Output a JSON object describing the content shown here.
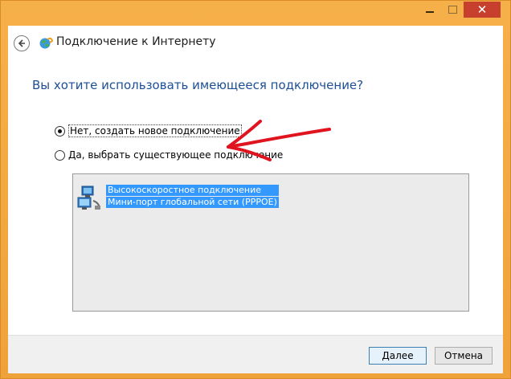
{
  "window": {
    "title_buttons": {
      "minimize": "minimize",
      "maximize": "maximize",
      "close": "close"
    }
  },
  "nav": {
    "title": "Подключение к Интернету"
  },
  "question": "Вы хотите использовать имеющееся подключение?",
  "options": [
    {
      "label": "Нет, создать новое подключение",
      "checked": true
    },
    {
      "label": "Да, выбрать существующее подключение",
      "checked": false
    }
  ],
  "connection_item": {
    "line1": "Высокоскоростное подключение",
    "line2": "Мини-порт глобальной сети (PPPOE)"
  },
  "buttons": {
    "next": "Далее",
    "cancel": "Отмена"
  },
  "colors": {
    "window_frame": "#f3a73e",
    "question_text": "#1c4f96",
    "selection": "#3399ff",
    "annotation_arrow": "#e0141e",
    "close_button": "#c7402d"
  }
}
